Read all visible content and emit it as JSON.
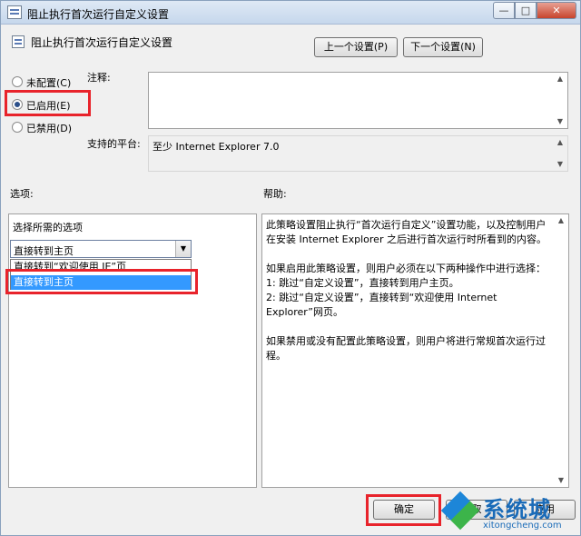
{
  "window": {
    "title": "阻止执行首次运行自定义设置",
    "controls": {
      "minimize": "—",
      "maximize": "□",
      "close": "✕"
    }
  },
  "policy": {
    "title": "阻止执行首次运行自定义设置",
    "prev_button": "上一个设置(P)",
    "next_button": "下一个设置(N)"
  },
  "state": {
    "options": [
      {
        "label": "未配置(C)",
        "checked": false
      },
      {
        "label": "已启用(E)",
        "checked": true
      },
      {
        "label": "已禁用(D)",
        "checked": false
      }
    ]
  },
  "comment": {
    "label": "注释:",
    "value": ""
  },
  "platform": {
    "label": "支持的平台:",
    "value": "至少 Internet Explorer 7.0"
  },
  "options_section": {
    "label": "选项:",
    "prompt": "选择所需的选项",
    "combo_value": "直接转到主页",
    "dropdown_items": [
      "直接转到“欢迎使用 IE”页",
      "直接转到主页"
    ],
    "selected_index": 1
  },
  "help_section": {
    "label": "帮助:",
    "text": "此策略设置阻止执行“首次运行自定义”设置功能，以及控制用户在安装 Internet Explorer 之后进行首次运行时所看到的内容。\n\n如果启用此策略设置，则用户必须在以下两种操作中进行选择：\n1: 跳过“自定义设置”，直接转到用户主页。\n2: 跳过“自定义设置”，直接转到“欢迎使用 Internet Explorer”网页。\n\n如果禁用或没有配置此策略设置，则用户将进行常规首次运行过程。"
  },
  "footer": {
    "ok_button": "确定",
    "cancel_button": "取",
    "apply_button": "应用"
  },
  "watermark": {
    "text": "系统城",
    "url": "xitongcheng.com"
  },
  "colors": {
    "highlight": "#e8232b",
    "selection": "#3399ff"
  }
}
